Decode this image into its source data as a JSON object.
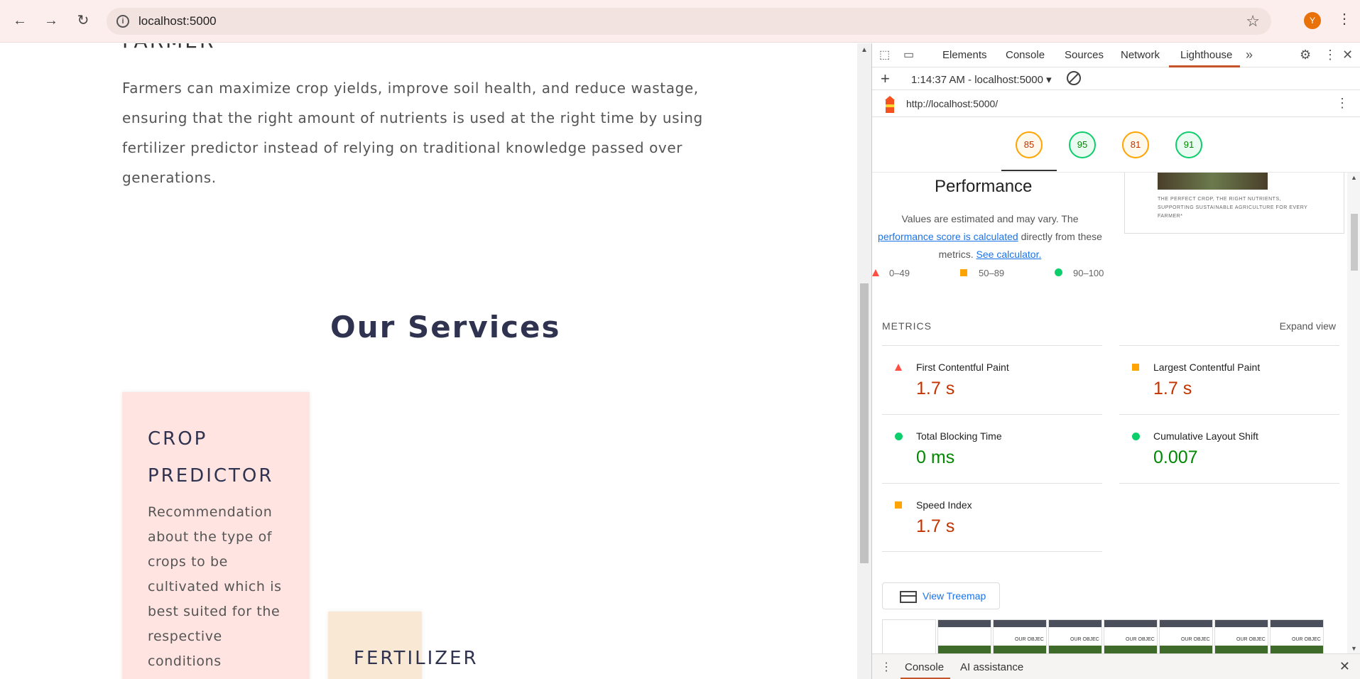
{
  "browser": {
    "url": "localhost:5000",
    "avatar_initial": "Y"
  },
  "page": {
    "partial_heading": "FARMER",
    "intro": "Farmers can maximize crop yields, improve soil health, and reduce wastage, ensuring that the right amount of nutrients is used at the right time by using fertilizer predictor instead of relying on traditional knowledge passed over generations.",
    "services_title": "Our Services",
    "cards": [
      {
        "title": "CROP PREDICTOR",
        "description": "Recommendation about the type of crops to be cultivated which is best suited for the respective conditions"
      },
      {
        "title": "FERTILIZER",
        "description": ""
      }
    ]
  },
  "devtools": {
    "tabs": [
      "Elements",
      "Console",
      "Sources",
      "Network",
      "Lighthouse"
    ],
    "active_tab": "Lighthouse",
    "session": "1:14:37 AM - localhost:5000 ▾",
    "report_url": "http://localhost:5000/",
    "scores": [
      85,
      95,
      81,
      91
    ],
    "score_colors": [
      "orange",
      "green",
      "orange",
      "green"
    ],
    "performance": {
      "title": "Performance",
      "note_1": "Values are estimated and may vary. The",
      "note_link": "performance score is calculated",
      "note_2": "directly from these metrics.",
      "note_calc": "See calculator.",
      "thumb_caption": "THE PERFECT CROP, THE RIGHT NUTRIENTS, SUPPORTING SUSTAINABLE AGRICULTURE FOR EVERY FARMER*"
    },
    "legend": [
      "0–49",
      "50–89",
      "90–100"
    ],
    "metrics_label": "METRICS",
    "expand_label": "Expand view",
    "metrics": [
      {
        "name": "First Contentful Paint",
        "value": "1.7 s",
        "status": "bad-red"
      },
      {
        "name": "Largest Contentful Paint",
        "value": "1.7 s",
        "status": "average"
      },
      {
        "name": "Total Blocking Time",
        "value": "0 ms",
        "status": "good"
      },
      {
        "name": "Cumulative Layout Shift",
        "value": "0.007",
        "status": "good"
      },
      {
        "name": "Speed Index",
        "value": "1.7 s",
        "status": "average"
      }
    ],
    "treemap_label": "View Treemap",
    "filmstrip_text": "OUR OBJEC",
    "drawer": {
      "tab1": "Console",
      "tab2": "AI assistance"
    }
  },
  "colors": {
    "accent": "#c5542a",
    "orange": "#ffa400",
    "green": "#0cce6b",
    "red": "#ff4e42",
    "link": "#1a73e8"
  }
}
